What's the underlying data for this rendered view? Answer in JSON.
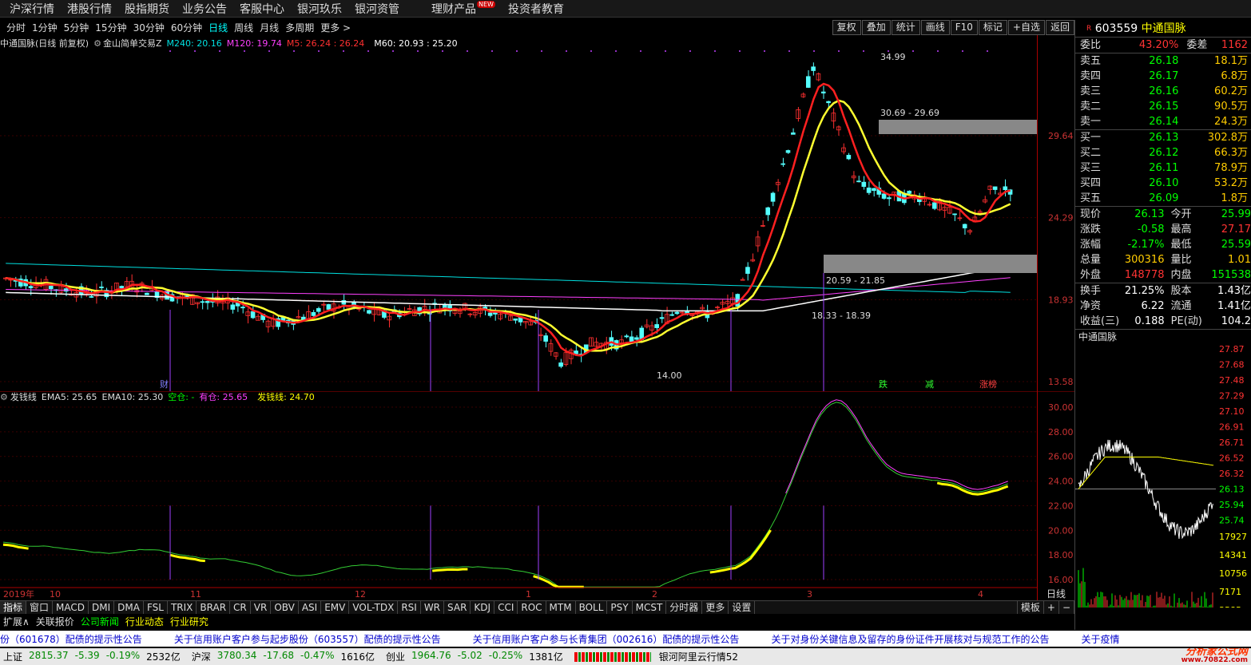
{
  "nav": [
    {
      "label": "沪深行情"
    },
    {
      "label": "港股行情"
    },
    {
      "label": "股指期货"
    },
    {
      "label": "业务公告"
    },
    {
      "label": "客服中心"
    },
    {
      "label": "银河玖乐"
    },
    {
      "label": "银河资管"
    },
    {
      "label": "理财产品",
      "badge": "NEW"
    },
    {
      "label": "投资者教育"
    }
  ],
  "periods": [
    "分时",
    "1分钟",
    "5分钟",
    "15分钟",
    "30分钟",
    "60分钟",
    "日线",
    "周线",
    "月线",
    "多周期",
    "更多 >"
  ],
  "active_period": "日线",
  "tool_buttons": [
    "复权",
    "叠加",
    "统计",
    "画线",
    "F10",
    "标记",
    "+自选",
    "返回"
  ],
  "main_legend": {
    "name": "中通国脉(日线 前复权)",
    "indicator": "金山简单交易Z",
    "m240": "M240: 20.16",
    "m120": "M120: 19.74",
    "m5": "M5: 26.24 : 26.24",
    "m60": "M60: 20.93 : 25.20",
    "colors": {
      "m240": "#00e0e0",
      "m120": "#ff40ff",
      "m5": "#ff3030",
      "m60": "#ffffff"
    }
  },
  "main_axis": [
    "29.64",
    "24.29",
    "18.93",
    "13.58"
  ],
  "main_annotations": {
    "high": "34.99",
    "low": "14.00",
    "zone1": "30.69 - 29.69",
    "zone2": "20.59 - 21.85",
    "zone3": "18.33 - 18.39"
  },
  "event_tags": [
    {
      "label": "财",
      "color": "#8080ff"
    },
    {
      "label": "跌",
      "color": "#30ff30"
    },
    {
      "label": "减",
      "color": "#30ff30"
    },
    {
      "label": "涨榜",
      "color": "#ff4040"
    }
  ],
  "sub_legend": {
    "name": "发钱线",
    "ema5": "EMA5: 25.65",
    "ema10": "EMA10: 25.30",
    "kongcang": "空仓: -",
    "youcang": "有仓: 25.65",
    "faqianxian": "发钱线: 24.70"
  },
  "sub_axis": [
    "30.00",
    "28.00",
    "26.00",
    "24.00",
    "22.00",
    "20.00",
    "18.00",
    "16.00"
  ],
  "time_axis": [
    "2019年",
    "10",
    "11",
    "12",
    "1",
    "2",
    "3",
    "4"
  ],
  "time_axis_label": "日线",
  "indicator_tabs": [
    "指标",
    "窗口",
    "MACD",
    "DMI",
    "DMA",
    "FSL",
    "TRIX",
    "BRAR",
    "CR",
    "VR",
    "OBV",
    "ASI",
    "EMV",
    "VOL-TDX",
    "RSI",
    "WR",
    "SAR",
    "KDJ",
    "CCI",
    "ROC",
    "MTM",
    "BOLL",
    "PSY",
    "MCST",
    "分时器",
    "更多",
    "设置"
  ],
  "template_label": "模板",
  "ext_tabs": [
    {
      "label": "扩展∧",
      "color": "#ddd"
    },
    {
      "label": "关联报价",
      "color": "#ddd"
    },
    {
      "label": "公司新闻",
      "color": "#0f0"
    },
    {
      "label": "行业动态",
      "color": "#ff0"
    },
    {
      "label": "行业研究",
      "color": "#ff0"
    }
  ],
  "ticker": [
    "份（601678）配债的提示性公告",
    "关于信用账户客户参与起步股份（603557）配债的提示性公告",
    "关于信用账户客户参与长青集团（002616）配债的提示性公告",
    "关于对身份关键信息及留存的身份证件开展核对与规范工作的公告",
    "关于疫情"
  ],
  "status": {
    "sh_label": "上证",
    "sh_val": "2815.37",
    "sh_chg": "-5.39",
    "sh_pct": "-0.19%",
    "sh_amt": "2532亿",
    "sz_label": "沪深",
    "sz_val": "3780.34",
    "sz_chg": "-17.68",
    "sz_pct": "-0.47%",
    "sz_amt": "1616亿",
    "cy_label": "创业",
    "cy_val": "1964.76",
    "cy_chg": "-5.02",
    "cy_pct": "-0.25%",
    "cy_amt": "1381亿",
    "server": "银河阿里云行情52",
    "watermark": "分析家公式网",
    "watermark_url": "www.70822.com"
  },
  "quote": {
    "code": "603559",
    "name": "中通国脉",
    "ratio_label": "委比",
    "ratio": "43.20%",
    "diff_label": "委差",
    "diff": "1162",
    "asks": [
      {
        "label": "卖五",
        "price": "26.18",
        "vol": "18.1万"
      },
      {
        "label": "卖四",
        "price": "26.17",
        "vol": "6.8万"
      },
      {
        "label": "卖三",
        "price": "26.16",
        "vol": "60.2万"
      },
      {
        "label": "卖二",
        "price": "26.15",
        "vol": "90.5万"
      },
      {
        "label": "卖一",
        "price": "26.14",
        "vol": "24.3万"
      }
    ],
    "bids": [
      {
        "label": "买一",
        "price": "26.13",
        "vol": "302.8万"
      },
      {
        "label": "买二",
        "price": "26.12",
        "vol": "66.3万"
      },
      {
        "label": "买三",
        "price": "26.11",
        "vol": "78.9万"
      },
      {
        "label": "买四",
        "price": "26.10",
        "vol": "53.2万"
      },
      {
        "label": "买五",
        "price": "26.09",
        "vol": "1.8万"
      }
    ],
    "stats": [
      {
        "l1": "现价",
        "v1": "26.13",
        "l2": "今开",
        "v2": "25.99",
        "c1": "#0f0",
        "c2": "#0f0"
      },
      {
        "l1": "涨跌",
        "v1": "-0.58",
        "l2": "最高",
        "v2": "27.17",
        "c1": "#0f0",
        "c2": "#f33"
      },
      {
        "l1": "涨幅",
        "v1": "-2.17%",
        "l2": "最低",
        "v2": "25.59",
        "c1": "#0f0",
        "c2": "#0f0"
      },
      {
        "l1": "总量",
        "v1": "300316",
        "l2": "量比",
        "v2": "1.01",
        "c1": "#fc0",
        "c2": "#fc0"
      },
      {
        "l1": "外盘",
        "v1": "148778",
        "l2": "内盘",
        "v2": "151538",
        "c1": "#f33",
        "c2": "#0f0"
      }
    ],
    "stats2": [
      {
        "l1": "换手",
        "v1": "21.25%",
        "l2": "股本",
        "v2": "1.43亿"
      },
      {
        "l1": "净资",
        "v1": "6.22",
        "l2": "流通",
        "v2": "1.41亿"
      },
      {
        "l1": "收益(三)",
        "v1": "0.188",
        "l2": "PE(动)",
        "v2": "104.2"
      }
    ],
    "mini_title": "中通国脉",
    "mini_axis": [
      "27.87",
      "27.68",
      "27.48",
      "27.29",
      "27.10",
      "26.91",
      "26.71",
      "26.52",
      "26.32",
      "26.13",
      "25.94",
      "25.74"
    ],
    "mini_vol_axis": [
      "17927",
      "14341",
      "10756",
      "7171",
      "3585"
    ]
  }
}
